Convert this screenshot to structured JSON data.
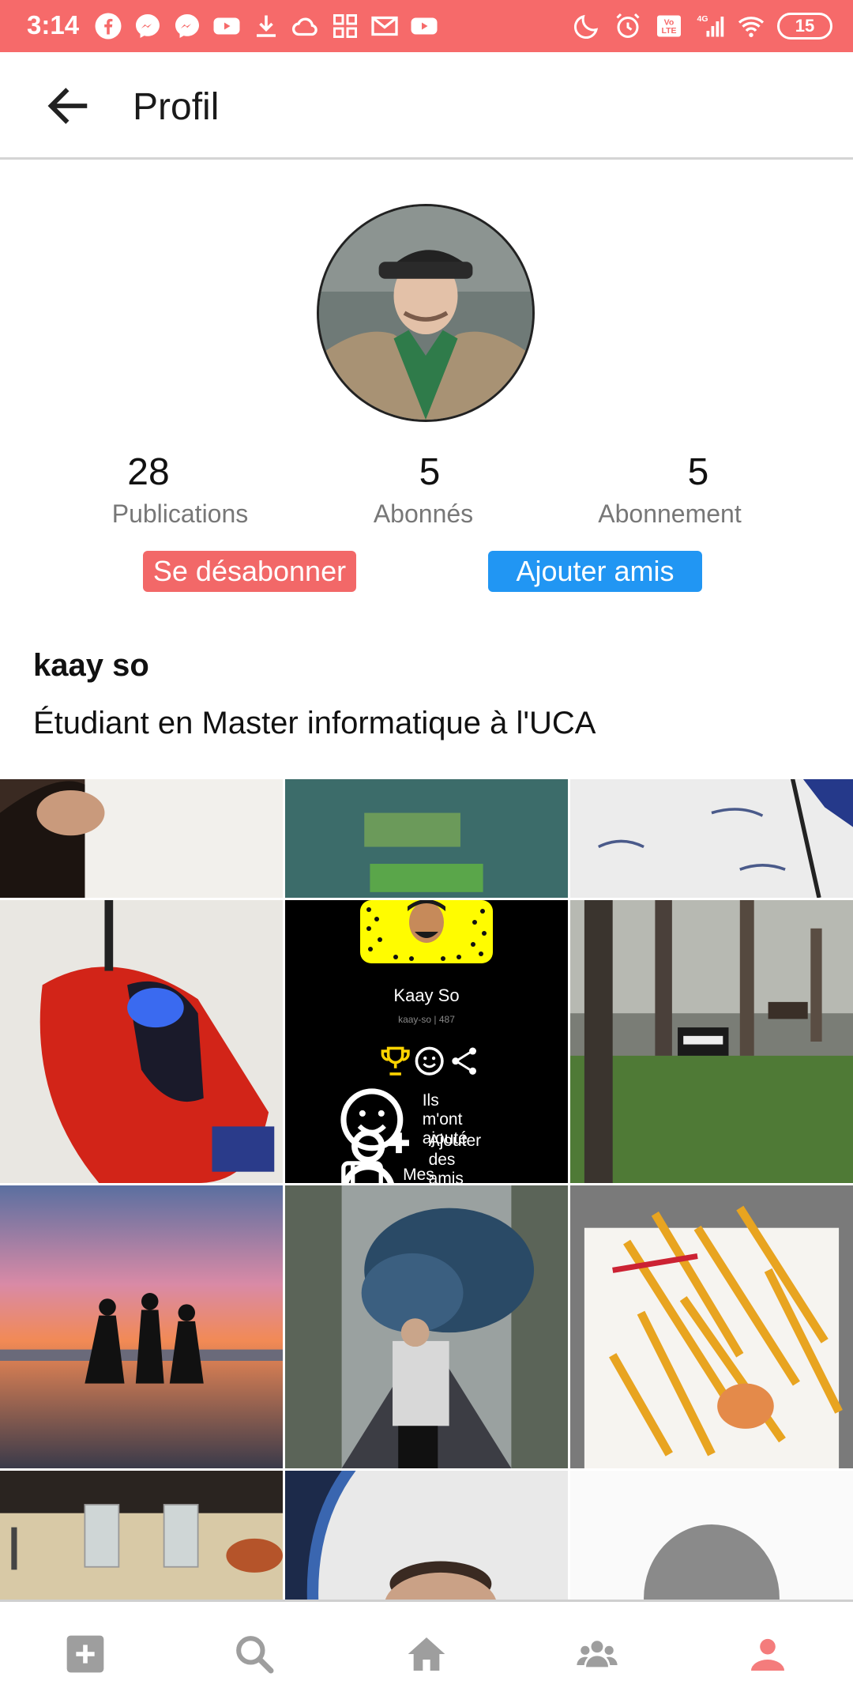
{
  "status_bar": {
    "time": "3:14",
    "battery": "15",
    "network": "4G",
    "background": "#f66a6a",
    "left_icons": [
      "facebook-icon",
      "messenger-icon",
      "messenger-icon",
      "youtube-icon",
      "download-icon",
      "cloud-icon",
      "apps-icon",
      "gmail-icon",
      "youtube-icon"
    ],
    "right_icons": [
      "moon-icon",
      "alarm-icon",
      "volte-icon",
      "signal-icon",
      "wifi-icon",
      "battery-icon"
    ]
  },
  "app_bar": {
    "title": "Profil",
    "back_icon": "arrow-left-icon"
  },
  "profile": {
    "avatar_icon": "profile-photo",
    "stats": [
      {
        "value": "28",
        "label": "Publications"
      },
      {
        "value": "5",
        "label": "Abonnés"
      },
      {
        "value": "5",
        "label": "Abonnement"
      }
    ],
    "unsubscribe_label": "Se désabonner",
    "add_friend_label": "Ajouter amis",
    "username": "kaay so",
    "bio": "Étudiant en Master informatique à l'UCA"
  },
  "snap_card": {
    "name": "Kaay So",
    "handle": "kaay-so | 487",
    "menu": [
      "Ils m'ont ajouté",
      "Ajouter des amis",
      "Mes Amis"
    ]
  },
  "colors": {
    "accent_red": "#f26868",
    "accent_blue": "#2196f3",
    "active_nav": "#f47c7c",
    "inactive_nav": "#9e9e9e"
  },
  "bottom_nav": [
    {
      "name": "add-post",
      "icon": "plus-square-icon",
      "active": false
    },
    {
      "name": "search",
      "icon": "search-icon",
      "active": false
    },
    {
      "name": "home",
      "icon": "home-icon",
      "active": false
    },
    {
      "name": "friends",
      "icon": "group-icon",
      "active": false
    },
    {
      "name": "profile",
      "icon": "person-icon",
      "active": true
    }
  ]
}
